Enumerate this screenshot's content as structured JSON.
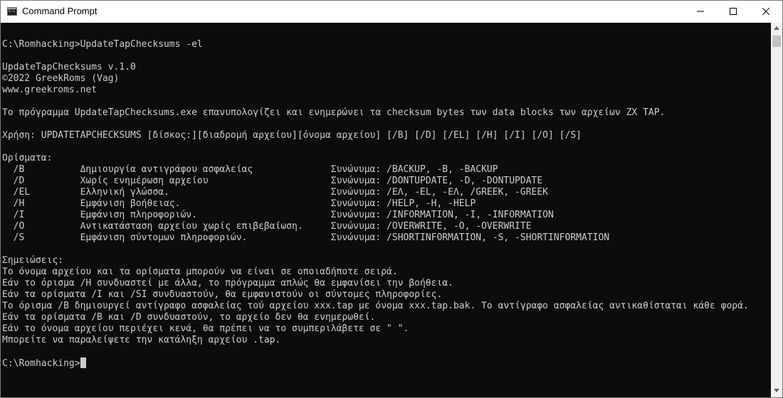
{
  "window": {
    "title": "Command Prompt",
    "icon": "cmd-icon"
  },
  "console": {
    "lines": [
      "",
      "C:\\Romhacking>UpdateTapChecksums -el",
      "",
      "UpdateTapChecksums v.1.0",
      "©2022 GreekRoms (Vag)",
      "www.greekroms.net",
      "",
      "Το πρόγραμμα UpdateTapChecksums.exe επανυπολογίζει και ενημερώνει τα checksum bytes των data blocks των αρχείων ZX TAP.",
      "",
      "Χρήση: UPDATETAPCHECKSUMS [δίσκος:][διαδρομή αρχείου][όνομα αρχείου] [/B] [/D] [/EL] [/H] [/I] [/O] [/S]",
      "",
      "Ορίσματα:",
      "  /B          Δημιουργία αντιγράφου ασφαλείας              Συνώνυμα: /BACKUP, -B, -BACKUP",
      "  /D          Χωρίς ενημέρωση αρχείου                      Συνώνυμα: /DONTUPDATE, -D, -DONTUPDATE",
      "  /EL         Ελληνική γλώσσα.                             Συνώνυμα: /ΕΛ, -EL, -ΕΛ, /GREEK, -GREEK",
      "  /H          Εμφάνιση βοήθειας.                           Συνώνυμα: /HELP, -H, -HELP",
      "  /I          Εμφάνιση πληροφοριών.                        Συνώνυμα: /INFORMATION, -I, -INFORMATION",
      "  /O          Αντικατάσταση αρχείου χωρίς επιβεβαίωση.     Συνώνυμα: /OVERWRITE, -O, -OVERWRITE",
      "  /S          Εμφάνιση σύντομων πληροφοριών.               Συνώνυμα: /SHORTINFORMATION, -S, -SHORTINFORMATION",
      "",
      "Σημειώσεις:",
      "Το όνομα αρχείου και τα ορίσματα μπορούν να είναι σε οποιαδήποτε σειρά.",
      "Εάν το όρισμα /H συνδυαστεί με άλλα, το πρόγραμμα απλώς θα εμφανίσει την βοήθεια.",
      "Εάν τα ορίσματα /I και /SI συνδυαστούν, θα εμφανιστούν οι σύντομες πληροφορίες.",
      "Το όρισμα /B δημιουργεί αντίγραφο ασφαλείας τού αρχείου xxx.tap με όνομα xxx.tap.bak. Το αντίγραφο ασφαλείας αντικαθίσταται κάθε φορά.",
      "Εάν τα ορίσματα /B και /D συνδυαστούν, το αρχείο δεν θα ενημερωθεί.",
      "Εάν το όνομα αρχείου περιέχει κενά, θα πρέπει να το συμπεριλάβετε σε \" \".",
      "Μπορείτε να παραλείψετε την κατάληξη αρχείου .tap.",
      "",
      "C:\\Romhacking>"
    ]
  },
  "colors": {
    "console_bg": "#0c0c0c",
    "console_fg": "#cccccc",
    "titlebar_bg": "#ffffff"
  }
}
